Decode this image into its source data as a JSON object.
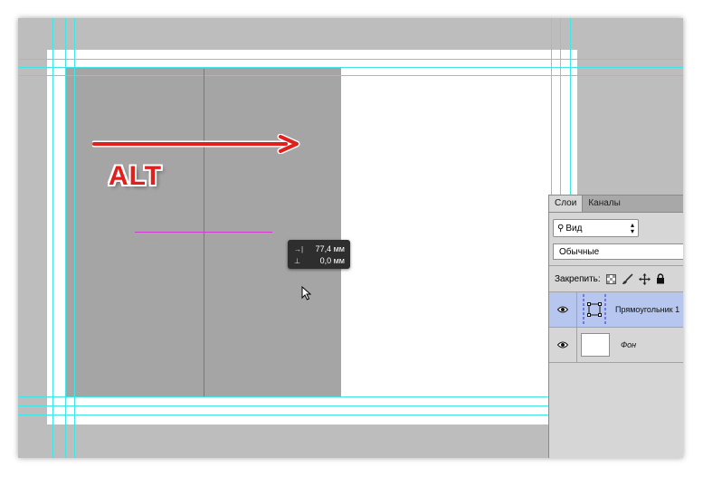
{
  "annotation": {
    "alt_label": "ALT"
  },
  "tooltip": {
    "dx_icon": "→|",
    "dx_value": "77,4 мм",
    "dy_icon": "⊥",
    "dy_value": "0,0 мм"
  },
  "layers_panel": {
    "tabs": [
      {
        "label": "Слои",
        "active": true
      },
      {
        "label": "Каналы",
        "active": false
      }
    ],
    "filter": {
      "icon": "search-icon",
      "value": "Вид"
    },
    "blend_mode": "Обычные",
    "lock_label": "Закрепить:",
    "layers": [
      {
        "name": "Прямоугольник 1",
        "selected": true,
        "type": "shape"
      },
      {
        "name": "Фон",
        "selected": false,
        "type": "background"
      }
    ]
  },
  "colors": {
    "canvas_bg": "#bdbdbd",
    "guides": "#3fe6e6",
    "smart_guides": "#d23ad2",
    "rectangle": "#a5a5a5",
    "arrow": "#e0201c",
    "selected_layer": "#b6c6ee"
  }
}
